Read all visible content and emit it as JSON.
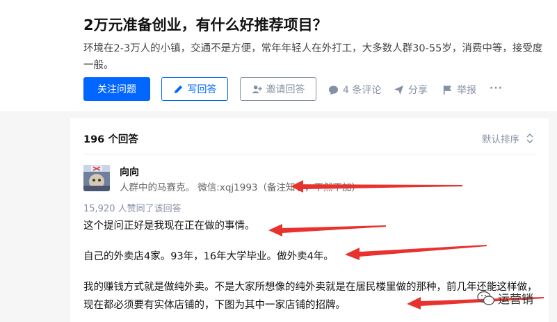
{
  "question": {
    "title": "2万元准备创业，有什么好推荐项目？",
    "description": "环境在2-3万人的小镇，交通不是方便，常年年轻人在外打工，大多数人群30-55岁，消费中等，接受度一般。"
  },
  "actions": {
    "follow_label": "关注问题",
    "write_label": "写回答",
    "invite_label": "邀请回答",
    "comment_label": "4 条评论",
    "share_label": "分享",
    "report_label": "举报",
    "more_label": "···"
  },
  "answers": {
    "count_label": "196 个回答",
    "sort_label": "默认排序"
  },
  "answer": {
    "author_name": "向向",
    "author_bio": "人群中的马赛克。 微信:xqj1993（备注知乎，不然不加）",
    "votes_label": "15,920 人赞同了该回答",
    "paragraphs": [
      "这个提问正好是我现在正在做的事情。",
      "自己的外卖店4家。93年，16年大学毕业。做外卖4年。",
      "我的赚钱方式就是做纯外卖。不是大家所想像的纯外卖就是在居民楼里做的那种，前几年还能这样做，现在都必须要有实体店铺的，下图为其中一家店铺的招牌。"
    ]
  },
  "watermark": {
    "text": "运营销"
  },
  "colors": {
    "primary": "#0066ff",
    "muted": "#8590a6",
    "arrow": "#e8322e"
  }
}
